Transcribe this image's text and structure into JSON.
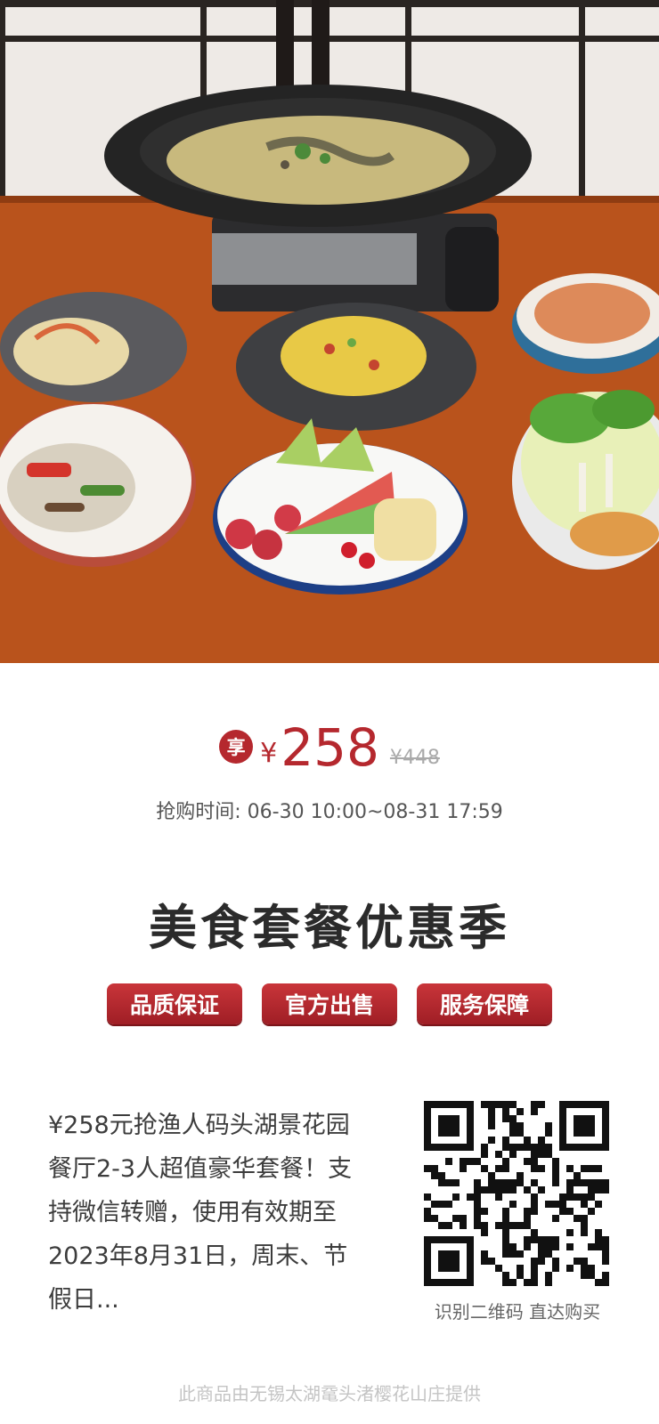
{
  "promo": {
    "share_badge": "享",
    "currency": "¥",
    "price": "258",
    "original_price": "¥448",
    "sale_time": "抢购时间: 06-30 10:00~08-31 17:59",
    "title": "美食套餐优惠季",
    "badges": [
      "品质保证",
      "官方出售",
      "服务保障"
    ],
    "description": "¥258元抢渔人码头湖景花园餐厅2-3人超值豪华套餐！支持微信转赠，使用有效期至2023年8月31日，周末、节假日...",
    "qr_caption": "识别二维码 直达购买",
    "provider": "此商品由无锡太湖鼋头渚樱花山庄提供"
  },
  "colors": {
    "accent": "#b5282e",
    "title": "#2b2b2b",
    "muted": "#aaaaaa"
  },
  "icons": {
    "share": "share-badge-icon",
    "qr": "qr-code-icon"
  }
}
